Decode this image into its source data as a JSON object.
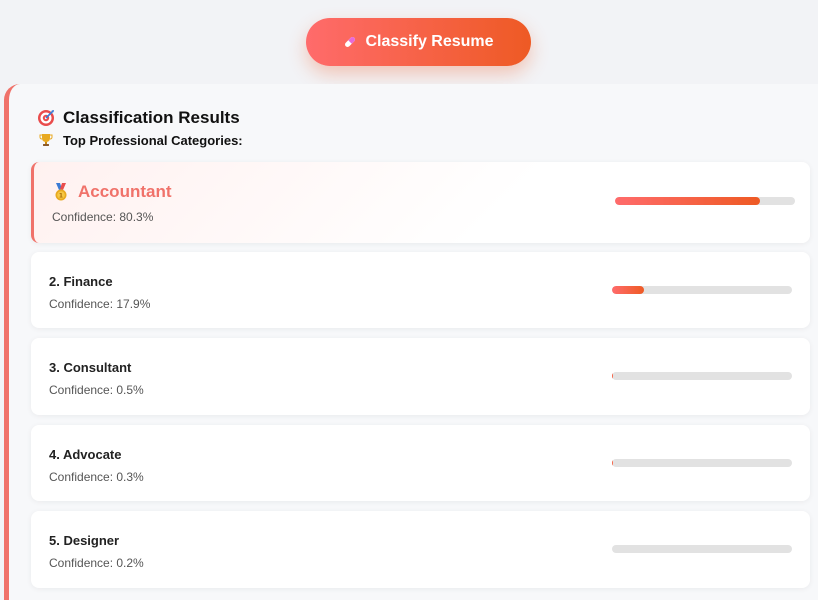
{
  "classify_button": {
    "label": "Classify Resume",
    "icon": "pill-icon"
  },
  "results": {
    "title": "Classification Results",
    "title_icon": "target-icon",
    "subtitle": "Top Professional Categories:",
    "subtitle_icon": "trophy-icon",
    "accent_color": "#f0726a",
    "bar_gradient": [
      "#ff6b6b",
      "#ee5a24"
    ],
    "items": [
      {
        "name": "Accountant",
        "confidence_text": "Confidence: 80.3%",
        "confidence": 80.3,
        "icon": "medal-icon"
      },
      {
        "name": "2. Finance",
        "confidence_text": "Confidence: 17.9%",
        "confidence": 17.9
      },
      {
        "name": "3. Consultant",
        "confidence_text": "Confidence: 0.5%",
        "confidence": 0.5
      },
      {
        "name": "4. Advocate",
        "confidence_text": "Confidence: 0.3%",
        "confidence": 0.3
      },
      {
        "name": "5. Designer",
        "confidence_text": "Confidence: 0.2%",
        "confidence": 0.2
      }
    ]
  }
}
